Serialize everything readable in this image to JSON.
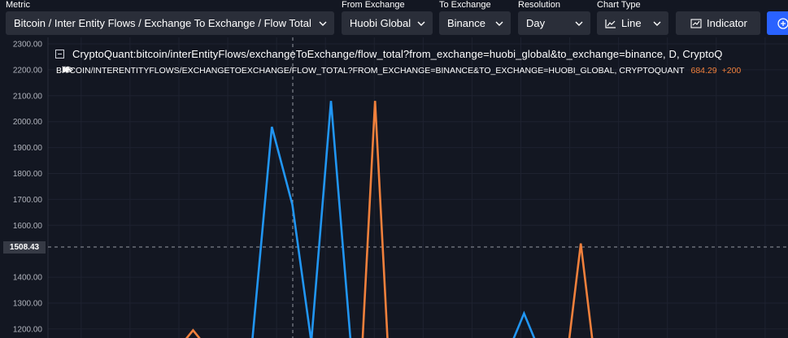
{
  "toolbar": {
    "metric": {
      "label": "Metric",
      "value": "Bitcoin / Inter Entity Flows / Exchange To Exchange / Flow Total"
    },
    "from_exchange": {
      "label": "From Exchange",
      "value": "Huobi Global"
    },
    "to_exchange": {
      "label": "To Exchange",
      "value": "Binance"
    },
    "resolution": {
      "label": "Resolution",
      "value": "Day"
    },
    "chart_type": {
      "label": "Chart Type",
      "value": "Line"
    },
    "indicator_label": "Indicator"
  },
  "chart": {
    "series_title_1": "CryptoQuant:bitcoin/interEntityFlows/exchangeToExchange/flow_total?from_exchange=huobi_global&to_exchange=binance, D, CryptoQ",
    "series_title_2": "BITCOIN/INTERENTITYFLOWS/EXCHANGETOEXCHANGE/FLOW_TOTAL?FROM_EXCHANGE=BINANCE&TO_EXCHANGE=HUOBI_GLOBAL, CRYPTOQUANT",
    "series_value_2": "684.29",
    "series_change_2": "+200",
    "crosshair_price": "1508.43",
    "colors": {
      "series_blue": "#2196f3",
      "series_orange": "#f0803c",
      "background": "#131722",
      "grid": "#1e2230"
    }
  },
  "chart_data": {
    "type": "line",
    "y_ticks": [
      "2300.00",
      "2200.00",
      "2100.00",
      "2000.00",
      "1900.00",
      "1800.00",
      "1700.00",
      "1600.00",
      "1400.00",
      "1300.00",
      "1200.00"
    ],
    "ylim": [
      1160,
      2320
    ],
    "grid": true,
    "series": [
      {
        "points": [
          [
            0.32,
            1150
          ],
          [
            0.345,
            1980
          ],
          [
            0.371,
            1680
          ],
          [
            0.395,
            1150
          ],
          [
            0.42,
            2080
          ],
          [
            0.445,
            1150
          ],
          [
            0.65,
            1150
          ],
          [
            0.665,
            1260
          ],
          [
            0.68,
            1150
          ]
        ]
      },
      {
        "points": [
          [
            0.233,
            1150
          ],
          [
            0.245,
            1195
          ],
          [
            0.257,
            1150
          ],
          [
            0.46,
            1150
          ],
          [
            0.476,
            2080
          ],
          [
            0.492,
            1150
          ],
          [
            0.722,
            1150
          ],
          [
            0.737,
            1530
          ],
          [
            0.752,
            1150
          ]
        ]
      }
    ]
  }
}
